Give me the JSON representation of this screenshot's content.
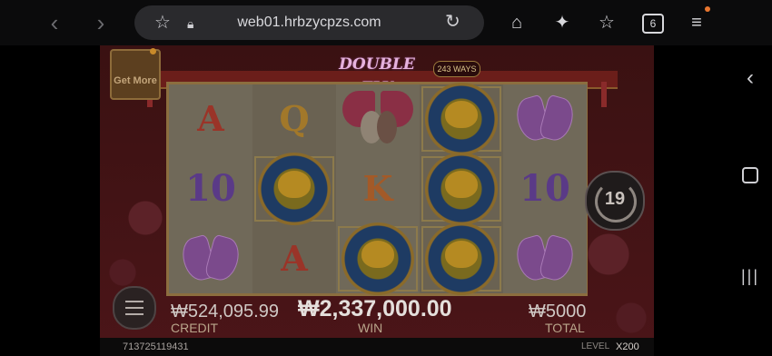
{
  "browser": {
    "url": "web01.hrbzycpzs.com",
    "tab_count": "6"
  },
  "game": {
    "logo_text": "DOUBLE FLY",
    "ways_badge": "243 WAYS",
    "get_more_label": "Get More",
    "spin_count": "19",
    "reels": [
      [
        "A",
        "10",
        "butterfly"
      ],
      [
        "Q",
        "lotus",
        "A"
      ],
      [
        "birds",
        "K",
        "lotus"
      ],
      [
        "lotus",
        "lotus",
        "lotus"
      ],
      [
        "butterfly",
        "10",
        "butterfly"
      ]
    ],
    "credit_value": "₩524,095.99",
    "credit_label": "CREDIT",
    "win_value": "₩2,337,000.00",
    "win_label": "WIN",
    "total_value": "₩5000",
    "total_label": "TOTAL",
    "game_id": "713725119431",
    "level_label": "LEVEL",
    "level_value": "X200"
  },
  "colors": {
    "accent_notification": "#e8762f",
    "reel_frame": "#8c6e3f"
  }
}
